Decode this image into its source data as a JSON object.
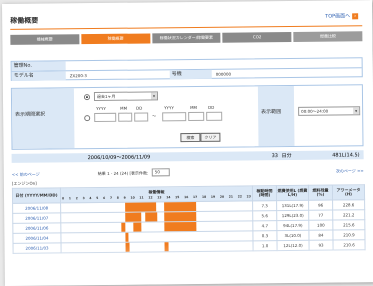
{
  "page": {
    "title": "稼働概要",
    "top_link": "TOP画面へ",
    "accent": "#f07c1f"
  },
  "tabs": [
    {
      "label": "機械概要"
    },
    {
      "label": "稼働概要",
      "active": true
    },
    {
      "label": "稼働状況カレンダー/稼働要素"
    },
    {
      "label": "CO2"
    },
    {
      "label": "燃費比較"
    }
  ],
  "machine": {
    "mgmt_no_label": "管理No.",
    "mgmt_no_value": "",
    "model_label": "モデル名",
    "model_value": "ZX200-3",
    "serial_label": "号機",
    "serial_value": "000000"
  },
  "filter": {
    "period_label": "表示期間選択",
    "period_option_select": "過去1ヶ月",
    "date_yyyy": "YYYY",
    "date_mm": "MM",
    "date_dd": "DD",
    "range_sep": "～",
    "time_range_label": "表示範囲",
    "time_range_value": "00:00～24:00",
    "search_button": "検索",
    "clear_button": "クリア"
  },
  "summary": {
    "date_range": "2006/10/09～2006/11/09",
    "days": "33",
    "days_unit": "日分",
    "hours": "481L(14.5)"
  },
  "pager": {
    "prev": "<< 前のページ",
    "result": "結果 1 - 24 (24) [表示件数:",
    "per_page": "50",
    "next": "次のページ >>"
  },
  "section_label": "[エンジンOn]",
  "table": {
    "headers": {
      "date": "日付 (YYYY/MM/DD)",
      "info": "稼働情報",
      "hours": "稼動時間 (時間)",
      "fuel": "燃費使用L (燃費L/H)",
      "fuel_amount": "燃料残量 (%)",
      "meter": "アワーメータ (H)"
    },
    "hour_ticks": [
      "0",
      "1",
      "2",
      "3",
      "4",
      "5",
      "6",
      "7",
      "8",
      "9",
      "10",
      "11",
      "12",
      "13",
      "14",
      "15",
      "16",
      "17",
      "18",
      "19",
      "20",
      "21",
      "22",
      "23"
    ],
    "rows": [
      {
        "date": "2006/11/08",
        "hours": "7.3",
        "fuel": "131L(17.9)",
        "fuel_amount": "96",
        "meter": "228.6",
        "segments": [
          [
            8,
            12
          ],
          [
            13,
            17
          ]
        ]
      },
      {
        "date": "2006/11/07",
        "hours": "5.6",
        "fuel": "129L(23.0)",
        "fuel_amount": "77",
        "meter": "221.2",
        "segments": [
          [
            8,
            10
          ],
          [
            10.5,
            12
          ],
          [
            13,
            17
          ]
        ]
      },
      {
        "date": "2006/11/06",
        "hours": "4.7",
        "fuel": "94L(17.9)",
        "fuel_amount": "100",
        "meter": "215.6",
        "segments": [
          [
            7.5,
            8
          ],
          [
            9,
            10
          ],
          [
            13,
            17
          ]
        ]
      },
      {
        "date": "2006/11/04",
        "hours": "0.3",
        "fuel": "3L(10.0)",
        "fuel_amount": "84",
        "meter": "210.9",
        "segments": [
          [
            8,
            8.4
          ]
        ]
      },
      {
        "date": "2006/11/03",
        "hours": "1.0",
        "fuel": "12L(12.0)",
        "fuel_amount": "93",
        "meter": "210.6",
        "segments": [
          [
            8,
            8.5
          ],
          [
            13,
            13.5
          ]
        ]
      }
    ]
  }
}
